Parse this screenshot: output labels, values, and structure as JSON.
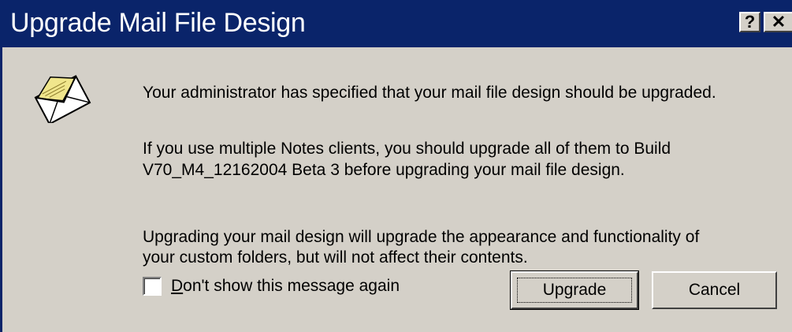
{
  "dialog": {
    "title": "Upgrade Mail File Design",
    "help_button": "?",
    "close_button": "✕",
    "icon": "envelope-icon",
    "messages": [
      "Your administrator has specified that your mail file design should be upgraded.",
      "If you use multiple Notes clients, you should upgrade all of them to Build",
      "V70_M4_12162004 Beta 3 before upgrading your mail file design.",
      "Upgrading your mail design will upgrade the appearance and functionality of",
      "your custom folders, but will not affect their contents."
    ],
    "checkbox": {
      "label_access_key": "D",
      "label_rest": "on't show this message again",
      "checked": false
    },
    "buttons": {
      "upgrade": "Upgrade",
      "cancel": "Cancel"
    }
  },
  "colors": {
    "titlebar": "#0a246a",
    "dialog_bg": "#d4d0c8"
  }
}
